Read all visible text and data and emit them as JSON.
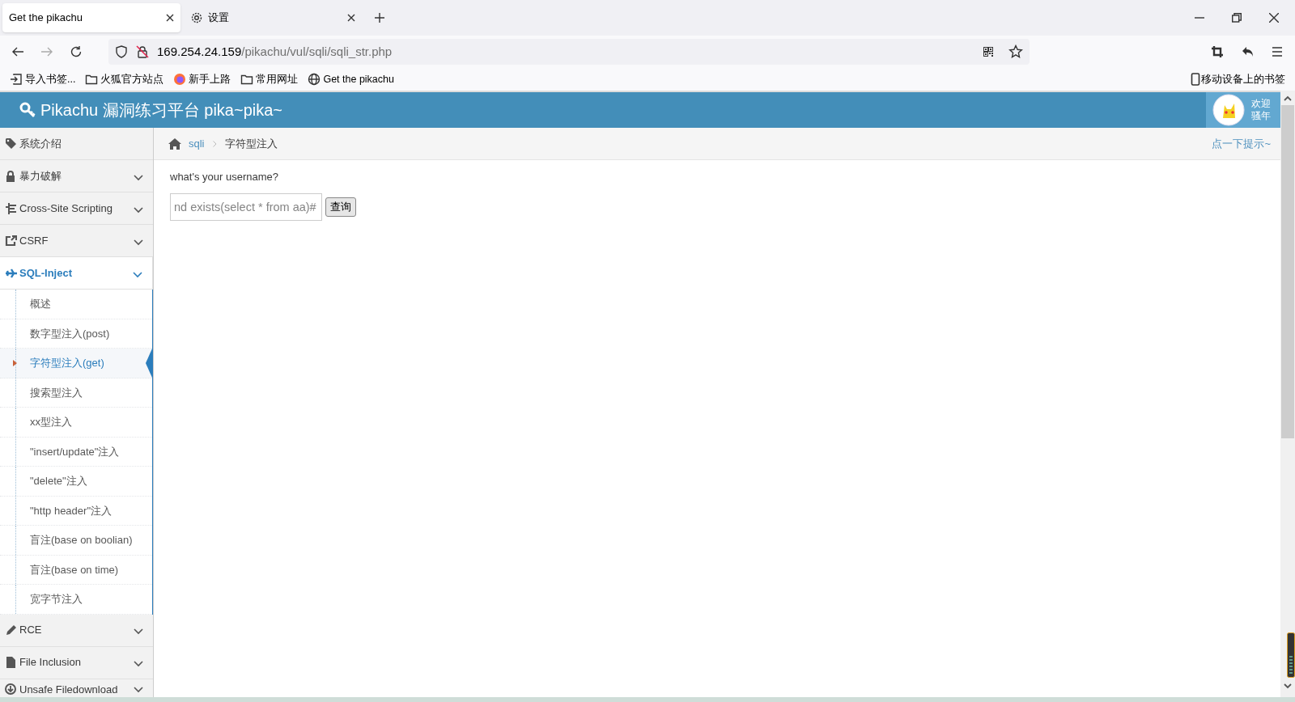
{
  "browser": {
    "tabs": [
      {
        "label": "Get the pikachu",
        "selected": true
      },
      {
        "label": "设置",
        "selected": false
      }
    ],
    "url": {
      "host": "169.254.24.159",
      "path": "/pikachu/vul/sqli/sqli_str.php"
    },
    "bookmarks": [
      {
        "label": "导入书签..."
      },
      {
        "label": "火狐官方站点"
      },
      {
        "label": "新手上路"
      },
      {
        "label": "常用网址"
      },
      {
        "label": "Get the pikachu"
      }
    ],
    "mobile_bookmarks": "移动设备上的书签"
  },
  "header": {
    "title": "Pikachu 漏洞练习平台 pika~pika~",
    "welcome": [
      "欢迎",
      "骚年"
    ]
  },
  "sidebar": {
    "items": [
      {
        "label": "系统介绍",
        "kind": "link"
      },
      {
        "label": "暴力破解",
        "kind": "group",
        "expanded": false
      },
      {
        "label": "Cross-Site Scripting",
        "kind": "group",
        "expanded": false
      },
      {
        "label": "CSRF",
        "kind": "group",
        "expanded": false
      },
      {
        "label": "SQL-Inject",
        "kind": "group",
        "expanded": true,
        "children": [
          {
            "label": "概述",
            "selected": false
          },
          {
            "label": "数字型注入(post)",
            "selected": false
          },
          {
            "label": "字符型注入(get)",
            "selected": true
          },
          {
            "label": "搜索型注入",
            "selected": false
          },
          {
            "label": "xx型注入",
            "selected": false
          },
          {
            "label": "\"insert/update\"注入",
            "selected": false
          },
          {
            "label": "\"delete\"注入",
            "selected": false
          },
          {
            "label": "\"http header\"注入",
            "selected": false
          },
          {
            "label": "盲注(base on boolian)",
            "selected": false
          },
          {
            "label": "盲注(base on time)",
            "selected": false
          },
          {
            "label": "宽字节注入",
            "selected": false
          }
        ]
      },
      {
        "label": "RCE",
        "kind": "group",
        "expanded": false
      },
      {
        "label": "File Inclusion",
        "kind": "group",
        "expanded": false
      },
      {
        "label": "Unsafe Filedownload",
        "kind": "group",
        "expanded": false
      }
    ]
  },
  "breadcrumb": {
    "link": "sqli",
    "current": "字符型注入",
    "hint": "点一下提示~"
  },
  "form": {
    "prompt": "what's your username?",
    "value": "nd exists(select * from aa)#",
    "button": "查询"
  }
}
